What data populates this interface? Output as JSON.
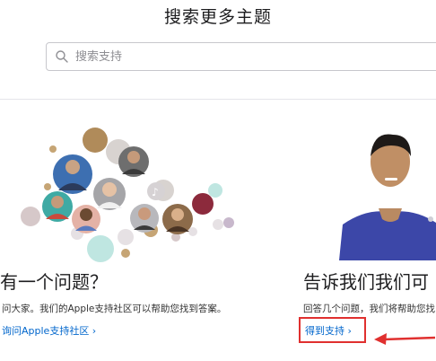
{
  "page": {
    "title": "搜索更多主题"
  },
  "search": {
    "placeholder": "搜索支持",
    "value": ""
  },
  "community_card": {
    "heading": "有一个问题？",
    "description": "问大家。我们的Apple支持社区可以帮助您找到答案。",
    "link_label": "询问Apple支持社区 ›"
  },
  "support_card": {
    "heading": "告诉我们我们可",
    "description": "回答几个问题，我们将帮助您找",
    "link_label": "得到支持 ›"
  },
  "colors": {
    "link": "#0066cc",
    "annotation": "#e0302f"
  }
}
